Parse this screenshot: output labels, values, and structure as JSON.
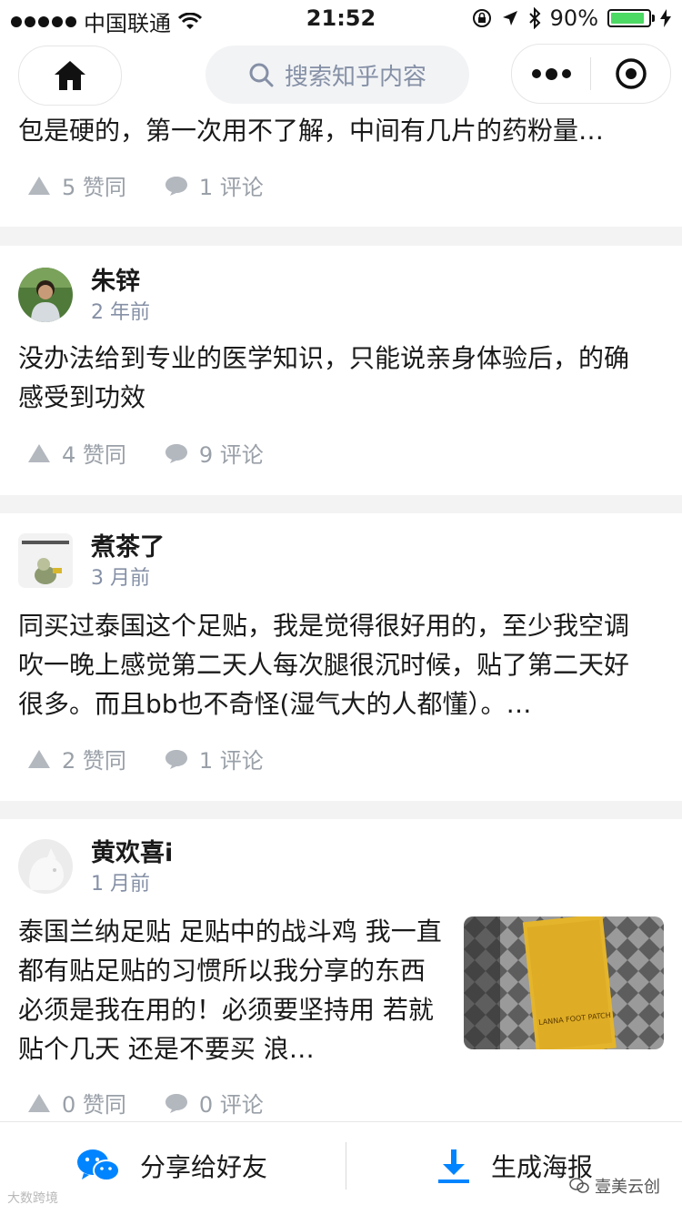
{
  "status_bar": {
    "carrier": "中国联通",
    "time": "21:52",
    "battery": "90%",
    "battery_level": 0.9
  },
  "nav": {
    "search_placeholder": "搜索知乎内容"
  },
  "first_card": {
    "text": "包是硬的，第一次用不了解，中间有几片的药粉量…",
    "likes": "5 赞同",
    "comments": "1 评论"
  },
  "answers": [
    {
      "author": "朱锌",
      "time": "2 年前",
      "text": "没办法给到专业的医学知识，只能说亲身体验后，的确感受到功效",
      "likes": "4 赞同",
      "comments": "9 评论"
    },
    {
      "author": "煮茶了",
      "time": "3 月前",
      "text": "同买过泰国这个足贴，我是觉得很好用的，至少我空调吹一晚上感觉第二天人每次腿很沉时候，贴了第二天好很多。而且bb也不奇怪(湿气大的人都懂）。…",
      "likes": "2 赞同",
      "comments": "1 评论"
    },
    {
      "author": "黄欢喜i",
      "time": "1 月前",
      "text": "泰国兰纳足贴 足贴中的战斗鸡 我一直都有贴足贴的习惯所以我分享的东西必须是我在用的！必须要坚持用 若就贴个几天 还是不要买 浪…",
      "likes": "0 赞同",
      "comments": "0 评论",
      "thumb_text": "LANNA FOOT PATCH"
    }
  ],
  "bottom_bar": {
    "share_label": "分享给好友",
    "poster_label": "生成海报"
  },
  "watermark": {
    "left": "大数跨境",
    "right": "壹美云创"
  },
  "colors": {
    "accent": "#0084ff",
    "battery": "#4cd964",
    "wechat": "#1aad19"
  }
}
